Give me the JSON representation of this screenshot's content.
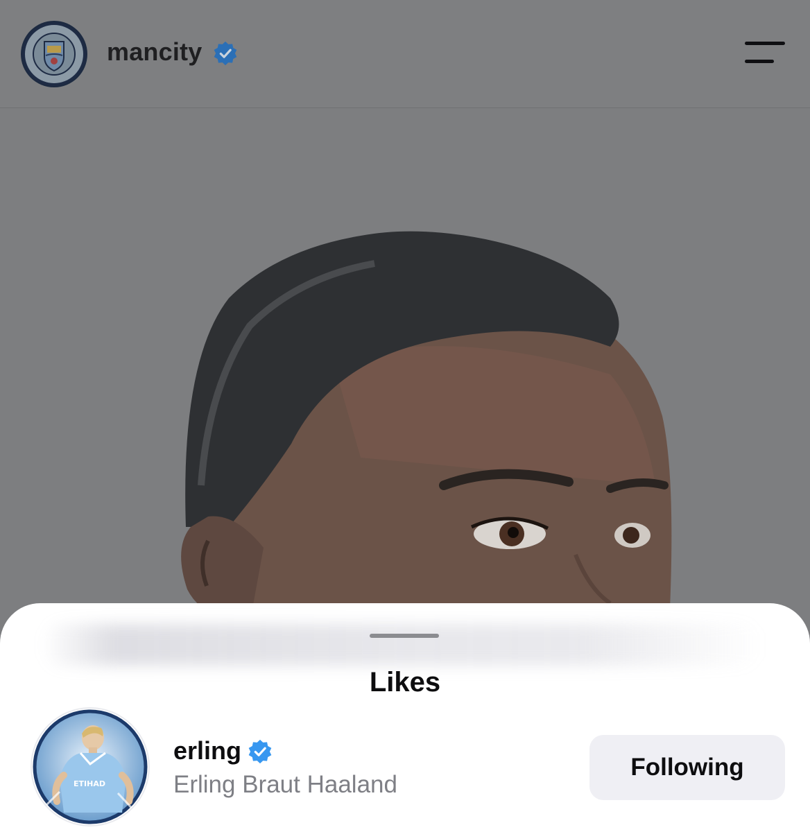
{
  "header": {
    "account_name": "mancity",
    "verified": true,
    "avatar_icon": "manchester-city-crest-icon",
    "menu_icon": "menu-icon"
  },
  "post": {
    "image_icon": "man-portrait-photo"
  },
  "likes_sheet": {
    "title": "Likes",
    "caption_blurred": true,
    "likers": [
      {
        "username": "erling",
        "full_name": "Erling Braut Haaland",
        "verified": true,
        "avatar_icon": "player-in-sky-blue-kit-avatar",
        "button_label": "Following"
      }
    ]
  },
  "colors": {
    "verified_blue": "#3797f0",
    "overlay_gray": "#7d7e80",
    "sheet_bg": "#ffffff",
    "button_bg": "#efeff4",
    "secondary_text": "#7e7f85"
  }
}
